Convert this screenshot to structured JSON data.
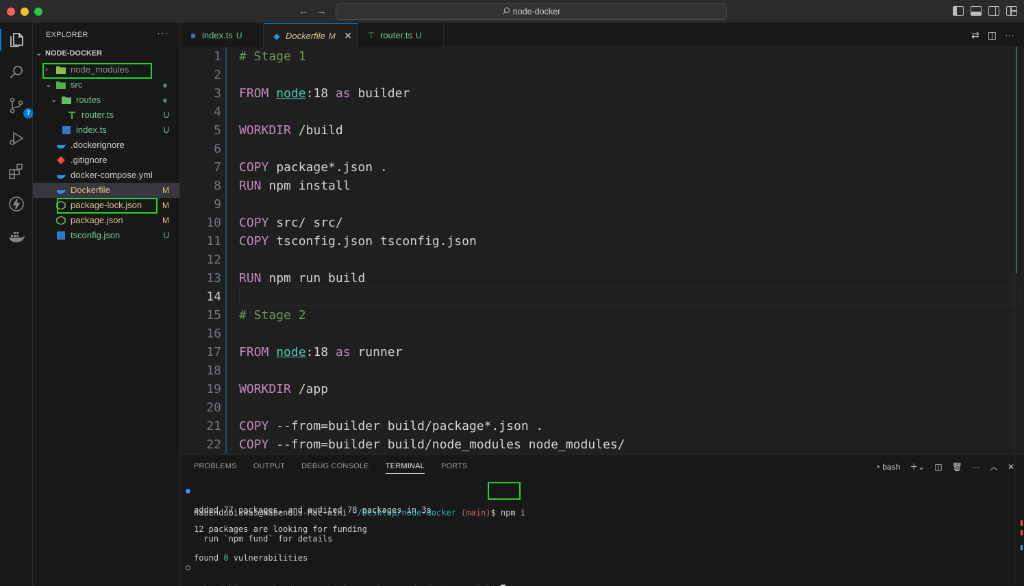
{
  "window": {
    "command_center": "node-docker"
  },
  "activity_bar": {
    "scm_badge": "7"
  },
  "explorer": {
    "title": "EXPLORER",
    "more": "···",
    "root": "NODE-DOCKER",
    "items": [
      {
        "name": "node_modules",
        "status": ""
      },
      {
        "name": "src",
        "status": ""
      },
      {
        "name": "routes",
        "status": ""
      },
      {
        "name": "router.ts",
        "status": "U"
      },
      {
        "name": "index.ts",
        "status": "U"
      },
      {
        "name": ".dockerignore",
        "status": ""
      },
      {
        "name": ".gitignore",
        "status": ""
      },
      {
        "name": "docker-compose.yml",
        "status": ""
      },
      {
        "name": "Dockerfile",
        "status": "M"
      },
      {
        "name": "package-lock.json",
        "status": "M"
      },
      {
        "name": "package.json",
        "status": "M"
      },
      {
        "name": "tsconfig.json",
        "status": "U"
      }
    ]
  },
  "tabs": [
    {
      "label": "index.ts",
      "status": "U"
    },
    {
      "label": "Dockerfile",
      "status": "M"
    },
    {
      "label": "router.ts",
      "status": "U"
    }
  ],
  "editor": {
    "current_line": 14,
    "line_numbers": [
      "1",
      "2",
      "3",
      "4",
      "5",
      "6",
      "7",
      "8",
      "9",
      "10",
      "11",
      "12",
      "13",
      "14",
      "15",
      "16",
      "17",
      "18",
      "19",
      "20",
      "21",
      "22"
    ],
    "code": {
      "l1": "# Stage 1",
      "l3_kw": "FROM",
      "l3_img": "node",
      "l3_tag": ":18",
      "l3_as": "as",
      "l3_name": "builder",
      "l5_kw": "WORKDIR",
      "l5_arg": "/build",
      "l7_kw": "COPY",
      "l7_arg": "package*.json .",
      "l8_kw": "RUN",
      "l8_arg": "npm install",
      "l10_kw": "COPY",
      "l10_arg": "src/ src/",
      "l11_kw": "COPY",
      "l11_arg": "tsconfig.json tsconfig.json",
      "l13_kw": "RUN",
      "l13_arg": "npm run build",
      "l15": "# Stage 2",
      "l17_kw": "FROM",
      "l17_img": "node",
      "l17_tag": ":18",
      "l17_as": "as",
      "l17_name": "runner",
      "l19_kw": "WORKDIR",
      "l19_arg": "/app",
      "l21_kw": "COPY",
      "l21_arg": "--from=builder build/package*.json .",
      "l22_kw": "COPY",
      "l22_arg": "--from=builder build/node_modules node_modules/"
    }
  },
  "panel": {
    "tabs": [
      "PROBLEMS",
      "OUTPUT",
      "DEBUG CONSOLE",
      "TERMINAL",
      "PORTS"
    ],
    "shell": "bash",
    "terminal": {
      "user": "nabendubiswas@Nabendus-Mac-mini",
      "path": "~/Desktop/node-docker",
      "branch": "(main)",
      "prompt": "$",
      "command": "npm i",
      "out1": "added 77 packages, and audited 78 packages in 3s",
      "out2": "12 packages are looking for funding",
      "out3": "  run `npm fund` for details",
      "out4_pre": "found ",
      "out4_zero": "0",
      "out4_post": " vulnerabilities"
    }
  }
}
